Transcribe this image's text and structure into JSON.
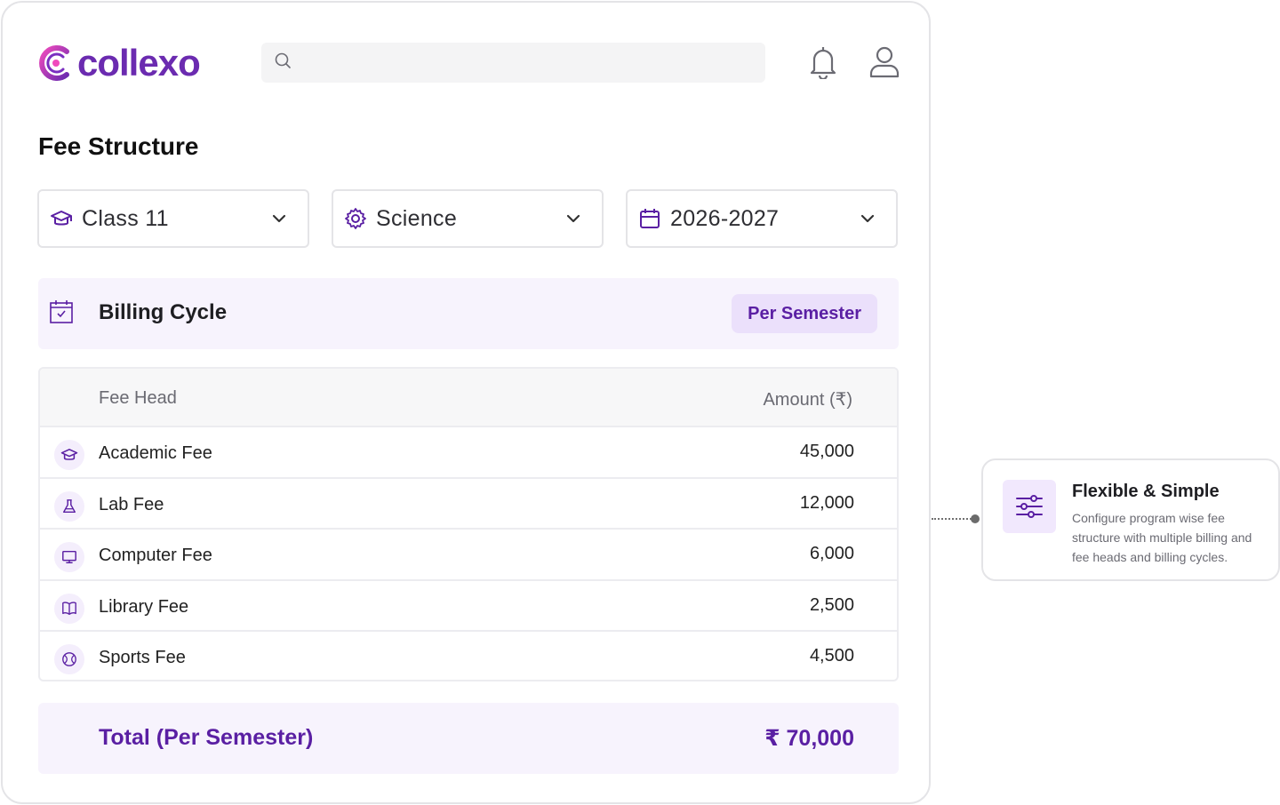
{
  "header": {
    "logo_text": "collexo",
    "search": {
      "value": "",
      "placeholder": ""
    }
  },
  "page": {
    "title": "Fee Structure"
  },
  "filters": [
    {
      "label": "Class 11",
      "icon": "graduation-cap-icon"
    },
    {
      "label": "Science",
      "icon": "gear-icon"
    },
    {
      "label": "2026-2027",
      "icon": "calendar-icon"
    }
  ],
  "billing": {
    "title": "Billing Cycle",
    "badge": "Per Semester"
  },
  "table": {
    "columns": {
      "head": "Fee Head",
      "amount": "Amount (₹)"
    },
    "rows": [
      {
        "name": "Academic Fee",
        "amount": "45,000",
        "icon": "graduation-cap-icon"
      },
      {
        "name": "Lab Fee",
        "amount": "12,000",
        "icon": "flask-icon"
      },
      {
        "name": "Computer Fee",
        "amount": "6,000",
        "icon": "monitor-icon"
      },
      {
        "name": "Library Fee",
        "amount": "2,500",
        "icon": "book-icon"
      },
      {
        "name": "Sports Fee",
        "amount": "4,500",
        "icon": "ball-icon"
      }
    ]
  },
  "total": {
    "label": "Total (Per Semester)",
    "value": "₹ 70,000"
  },
  "feature": {
    "title": "Flexible & Simple",
    "description": "Configure program wise fee structure with multiple billing and fee heads and billing cycles.",
    "icon": "sliders-icon"
  },
  "colors": {
    "brand": "#6b2bb0",
    "accent_dark": "#5a1fa3",
    "accent_bg": "#f7f3fd",
    "badge_bg": "#ebe0fb"
  }
}
